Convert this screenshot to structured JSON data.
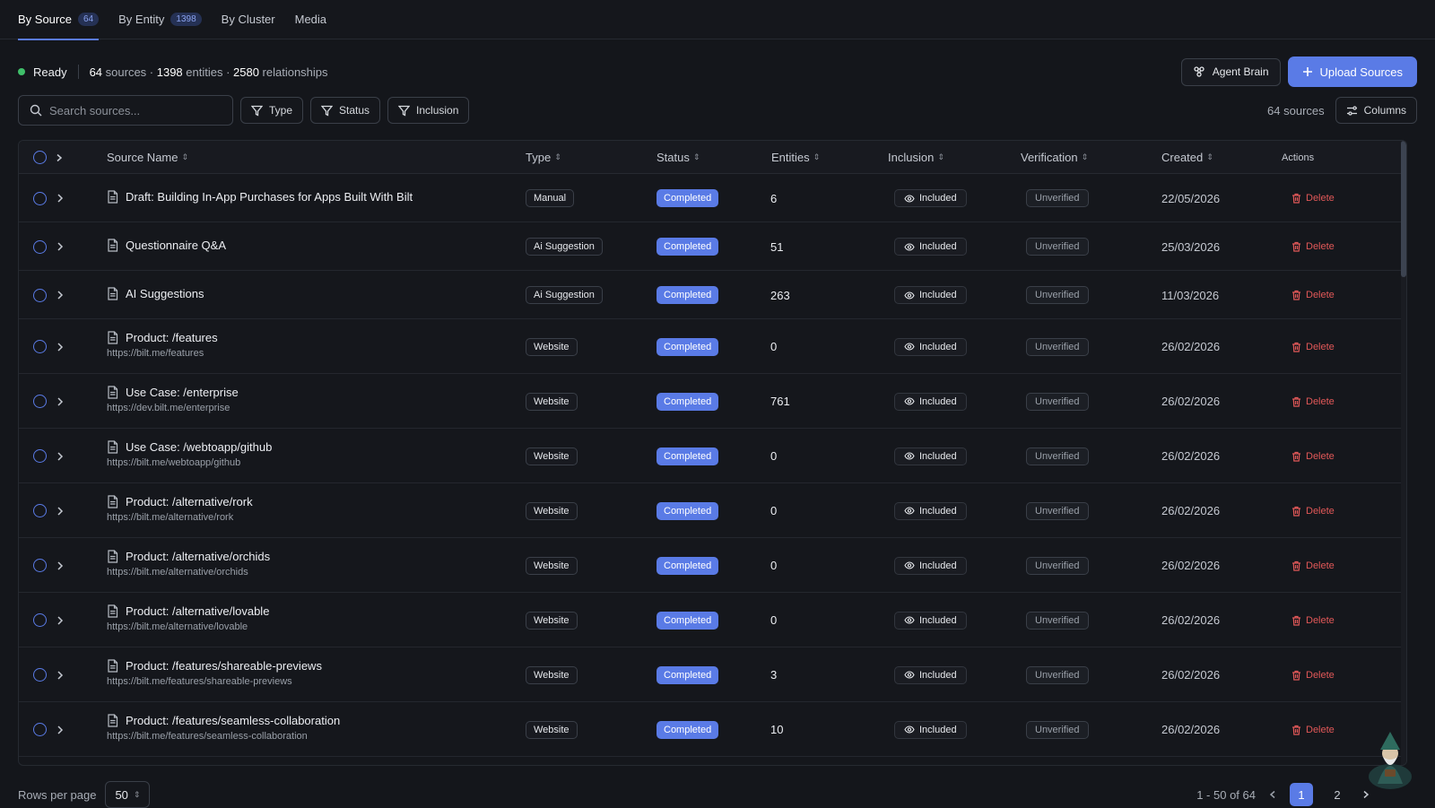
{
  "tabs": [
    {
      "label": "By Source",
      "badge": "64"
    },
    {
      "label": "By Entity",
      "badge": "1398"
    },
    {
      "label": "By Cluster",
      "badge": ""
    },
    {
      "label": "Media",
      "badge": ""
    }
  ],
  "status": {
    "state": "Ready",
    "sources_count": "64",
    "sources_word": " sources · ",
    "entities_count": "1398",
    "entities_word": " entities · ",
    "relationships_count": "2580",
    "relationships_word": " relationships"
  },
  "actions": {
    "agent_brain": "Agent Brain",
    "upload": "Upload Sources"
  },
  "filters": {
    "search_placeholder": "Search sources...",
    "type": "Type",
    "status": "Status",
    "inclusion": "Inclusion",
    "count_label": "64 sources",
    "columns": "Columns"
  },
  "table": {
    "headers": {
      "source_name": "Source Name",
      "type": "Type",
      "status": "Status",
      "entities": "Entities",
      "inclusion": "Inclusion",
      "verification": "Verification",
      "created": "Created",
      "actions": "Actions"
    },
    "delete_label": "Delete",
    "rows": [
      {
        "name": "Draft: Building In-App Purchases for Apps Built With Bilt",
        "url": "",
        "type": "Manual",
        "status": "Completed",
        "entities": "6",
        "inclusion": "Included",
        "verification": "Unverified",
        "created": "22/05/2026"
      },
      {
        "name": "Questionnaire Q&A",
        "url": "",
        "type": "Ai Suggestion",
        "status": "Completed",
        "entities": "51",
        "inclusion": "Included",
        "verification": "Unverified",
        "created": "25/03/2026"
      },
      {
        "name": "AI Suggestions",
        "url": "",
        "type": "Ai Suggestion",
        "status": "Completed",
        "entities": "263",
        "inclusion": "Included",
        "verification": "Unverified",
        "created": "11/03/2026"
      },
      {
        "name": "Product: /features",
        "url": "https://bilt.me/features",
        "type": "Website",
        "status": "Completed",
        "entities": "0",
        "inclusion": "Included",
        "verification": "Unverified",
        "created": "26/02/2026"
      },
      {
        "name": "Use Case: /enterprise",
        "url": "https://dev.bilt.me/enterprise",
        "type": "Website",
        "status": "Completed",
        "entities": "761",
        "inclusion": "Included",
        "verification": "Unverified",
        "created": "26/02/2026"
      },
      {
        "name": "Use Case: /webtoapp/github",
        "url": "https://bilt.me/webtoapp/github",
        "type": "Website",
        "status": "Completed",
        "entities": "0",
        "inclusion": "Included",
        "verification": "Unverified",
        "created": "26/02/2026"
      },
      {
        "name": "Product: /alternative/rork",
        "url": "https://bilt.me/alternative/rork",
        "type": "Website",
        "status": "Completed",
        "entities": "0",
        "inclusion": "Included",
        "verification": "Unverified",
        "created": "26/02/2026"
      },
      {
        "name": "Product: /alternative/orchids",
        "url": "https://bilt.me/alternative/orchids",
        "type": "Website",
        "status": "Completed",
        "entities": "0",
        "inclusion": "Included",
        "verification": "Unverified",
        "created": "26/02/2026"
      },
      {
        "name": "Product: /alternative/lovable",
        "url": "https://bilt.me/alternative/lovable",
        "type": "Website",
        "status": "Completed",
        "entities": "0",
        "inclusion": "Included",
        "verification": "Unverified",
        "created": "26/02/2026"
      },
      {
        "name": "Product: /features/shareable-previews",
        "url": "https://bilt.me/features/shareable-previews",
        "type": "Website",
        "status": "Completed",
        "entities": "3",
        "inclusion": "Included",
        "verification": "Unverified",
        "created": "26/02/2026"
      },
      {
        "name": "Product: /features/seamless-collaboration",
        "url": "https://bilt.me/features/seamless-collaboration",
        "type": "Website",
        "status": "Completed",
        "entities": "10",
        "inclusion": "Included",
        "verification": "Unverified",
        "created": "26/02/2026"
      }
    ]
  },
  "footer": {
    "rows_per_page_label": "Rows per page",
    "rows_per_page_value": "50",
    "range": "1 - 50 of 64",
    "pages": [
      "1",
      "2"
    ],
    "current_page": "1"
  },
  "colors": {
    "accent": "#5a7be6",
    "ready": "#3fbf6a",
    "danger": "#e25858",
    "background": "#14161b"
  },
  "icons": [
    "document-icon",
    "filter-icon",
    "search-icon",
    "eye-icon",
    "trash-icon",
    "plus-icon",
    "brain-icon",
    "columns-icon",
    "chevron-right-icon",
    "sort-icon"
  ]
}
